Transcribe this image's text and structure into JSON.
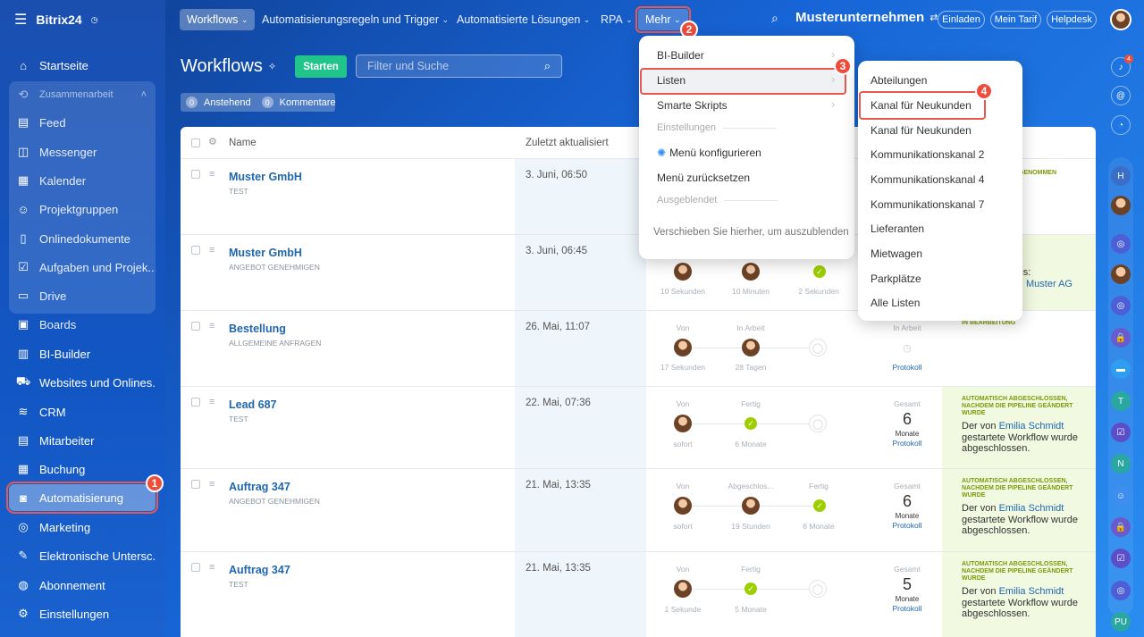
{
  "sidebar": {
    "logo": "Bitrix24",
    "items": [
      {
        "label": "Startseite",
        "icon": "home-icon"
      },
      {
        "label": "Zusammenarbeit",
        "icon": "collab-icon"
      },
      {
        "label": "Feed",
        "icon": "feed-icon"
      },
      {
        "label": "Messenger",
        "icon": "chat-icon"
      },
      {
        "label": "Kalender",
        "icon": "calendar-icon"
      },
      {
        "label": "Projektgruppen",
        "icon": "group-icon"
      },
      {
        "label": "Onlinedokumente",
        "icon": "doc-icon"
      },
      {
        "label": "Aufgaben und Projek...",
        "icon": "task-icon"
      },
      {
        "label": "Drive",
        "icon": "drive-icon"
      },
      {
        "label": "Boards",
        "icon": "board-icon"
      },
      {
        "label": "BI-Builder",
        "icon": "bi-icon"
      },
      {
        "label": "Websites und Onlines...",
        "icon": "cart-icon"
      },
      {
        "label": "CRM",
        "icon": "crm-icon"
      },
      {
        "label": "Mitarbeiter",
        "icon": "staff-icon"
      },
      {
        "label": "Buchung",
        "icon": "booking-icon"
      },
      {
        "label": "Automatisierung",
        "icon": "robot-icon"
      },
      {
        "label": "Marketing",
        "icon": "target-icon"
      },
      {
        "label": "Elektronische Untersc...",
        "icon": "sign-icon"
      },
      {
        "label": "Abonnement",
        "icon": "sub-icon"
      },
      {
        "label": "Einstellungen",
        "icon": "gear-icon"
      }
    ]
  },
  "topnav": {
    "tabs": [
      "Workflows",
      "Automatisierungsregeln und Trigger",
      "Automatisierte Lösungen",
      "RPA",
      "Mehr"
    ],
    "company": "Musterunternehmen",
    "buttons": [
      "Einladen",
      "Mein Tarif",
      "Helpdesk"
    ]
  },
  "page": {
    "title": "Workflows",
    "start_button": "Starten",
    "search_placeholder": "Filter und Suche",
    "counters": [
      {
        "count": "0",
        "label": "Anstehend"
      },
      {
        "count": "0",
        "label": "Kommentare"
      }
    ]
  },
  "table": {
    "columns": [
      "Name",
      "Zuletzt aktualisiert"
    ],
    "rows": [
      {
        "name": "Muster GmbH",
        "sub": "TEST",
        "date": "3. Juni, 06:50",
        "result_title": "GENOMMEN"
      },
      {
        "name": "Muster GmbH",
        "sub": "ANGEBOT GENEHMIGEN",
        "date": "3. Juni, 06:45",
        "times": [
          "10 Sekunden",
          "10 Minuten",
          "2 Sekunden"
        ],
        "result_text": "ebnis:",
        "result_link": "Muster AG"
      },
      {
        "name": "Bestellung",
        "sub": "ALLGEMEINE ANFRAGEN",
        "date": "26. Mai, 11:07",
        "labels": [
          "Von",
          "In Arbeit",
          "",
          "In Arbeit"
        ],
        "times": [
          "17 Sekunden",
          "28 Tagen"
        ],
        "protokoll": "Protokoll",
        "result_title": "IN BEARBEITUNG"
      },
      {
        "name": "Lead 687",
        "sub": "TEST",
        "date": "22. Mai, 07:36",
        "labels": [
          "Von",
          "Fertig",
          "",
          "Gesamt"
        ],
        "times": [
          "sofort",
          "6 Monate"
        ],
        "total": "6",
        "unit": "Monate",
        "protokoll": "Protokoll",
        "result_title": "AUTOMATISCH ABGESCHLOSSEN, NACHDEM DIE PIPELINE GEÄNDERT WURDE",
        "result_pre": "Der von ",
        "result_link": "Emilia Schmidt",
        "result_post": " gestartete Workflow wurde abgeschlossen."
      },
      {
        "name": "Auftrag 347",
        "sub": "ANGEBOT GENEHMIGEN",
        "date": "21. Mai, 13:35",
        "labels": [
          "Von",
          "Abgeschlos...",
          "Fertig",
          "Gesamt"
        ],
        "times": [
          "sofort",
          "19 Stunden",
          "6 Monate"
        ],
        "total": "6",
        "unit": "Monate",
        "protokoll": "Protokoll",
        "result_title": "AUTOMATISCH ABGESCHLOSSEN, NACHDEM DIE PIPELINE GEÄNDERT WURDE",
        "result_pre": "Der von ",
        "result_link": "Emilia Schmidt",
        "result_post": " gestartete Workflow wurde abgeschlossen."
      },
      {
        "name": "Auftrag 347",
        "sub": "TEST",
        "date": "21. Mai, 13:35",
        "labels": [
          "Von",
          "Fertig",
          "",
          "Gesamt"
        ],
        "times": [
          "1 Sekunde",
          "5 Monate"
        ],
        "total": "5",
        "unit": "Monate",
        "protokoll": "Protokoll",
        "result_title": "AUTOMATISCH ABGESCHLOSSEN, NACHDEM DIE PIPELINE GEÄNDERT WURDE",
        "result_pre": "Der von ",
        "result_link": "Emilia Schmidt",
        "result_post": " gestartete Workflow wurde abgeschlossen."
      }
    ]
  },
  "menu_mehr": {
    "items": [
      "BI-Builder",
      "Listen",
      "Smarte Skripts"
    ],
    "section_settings": "Einstellungen",
    "configure": "Menü konfigurieren",
    "reset": "Menü zurücksetzen",
    "section_hidden": "Ausgeblendet",
    "hint": "Verschieben Sie hierher, um auszublenden"
  },
  "menu_listen": {
    "items": [
      "Abteilungen",
      "Kanal für Neukunden",
      "Kanal für Neukunden",
      "Kommunikationskanal 2",
      "Kommunikationskanal 4",
      "Kommunikationskanal 7",
      "Lieferanten",
      "Mietwagen",
      "Parkplätze",
      "Alle Listen"
    ]
  },
  "callouts": [
    "1",
    "2",
    "3",
    "4"
  ],
  "rail": {
    "notifications": "4",
    "letters": [
      "H",
      "T",
      "N",
      "PU"
    ]
  }
}
